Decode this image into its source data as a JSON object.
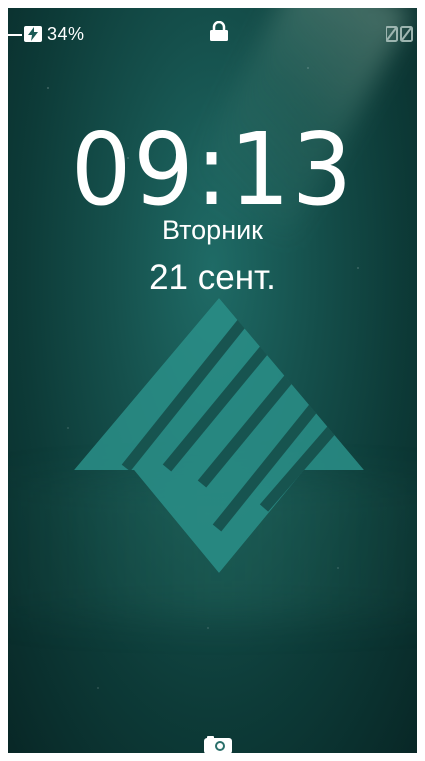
{
  "status_bar": {
    "battery_percent": "34%",
    "battery_icon": "battery-charging-icon",
    "lock_icon": "lock-icon",
    "sim_icons": "no-signal-icon"
  },
  "lockscreen": {
    "time": "09:13",
    "weekday": "Вторник",
    "date": "21 сент."
  },
  "wallpaper": {
    "logo": "triangle-stripes-logo",
    "accent_color": "#2a8f88",
    "background_color": "#0d3b38"
  },
  "bottom": {
    "camera_icon": "camera-icon"
  }
}
